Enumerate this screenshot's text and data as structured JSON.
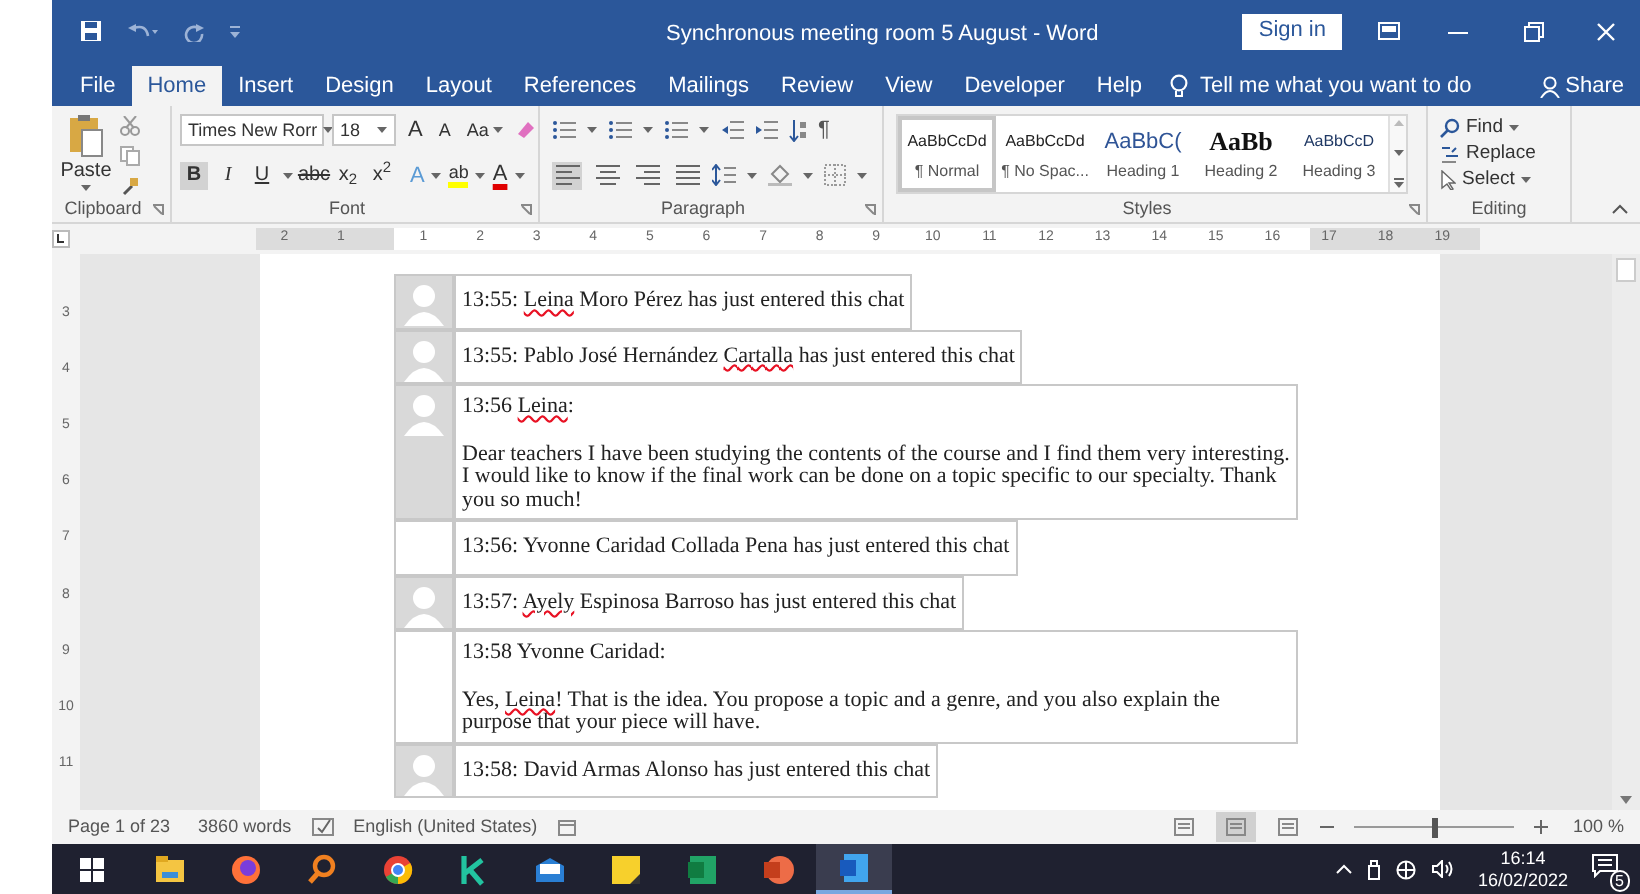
{
  "window": {
    "title": "Synchronous meeting room 5 August  -  Word",
    "sign_in": "Sign in"
  },
  "tabs": [
    {
      "label": "File",
      "selected": false
    },
    {
      "label": "Home",
      "selected": true
    },
    {
      "label": "Insert",
      "selected": false
    },
    {
      "label": "Design",
      "selected": false
    },
    {
      "label": "Layout",
      "selected": false
    },
    {
      "label": "References",
      "selected": false
    },
    {
      "label": "Mailings",
      "selected": false
    },
    {
      "label": "Review",
      "selected": false
    },
    {
      "label": "View",
      "selected": false
    },
    {
      "label": "Developer",
      "selected": false
    },
    {
      "label": "Help",
      "selected": false
    }
  ],
  "tell_me": {
    "placeholder": "Tell me what you want to do"
  },
  "share": "Share",
  "clipboard": {
    "paste": "Paste",
    "group_label": "Clipboard"
  },
  "font": {
    "name": "Times New Rorr",
    "size": "18",
    "grow": "A",
    "shrink": "A",
    "change_case": "Aa",
    "effects": "A",
    "highlight": "ab",
    "font_color_button": "A",
    "group_label": "Font",
    "format_buttons": [
      {
        "label": "B",
        "on": true
      },
      {
        "label": "I",
        "on": false
      },
      {
        "label": "U",
        "on": false
      },
      {
        "label": "abc",
        "on": false
      },
      {
        "label": "x$_{2}$",
        "on": false
      },
      {
        "label": "x$^{2}$",
        "on": false
      }
    ]
  },
  "paragraph": {
    "pilcrow": "¶",
    "group_label": "Paragraph",
    "alignments": [
      {
        "selected": true
      },
      {
        "selected": false
      },
      {
        "selected": false
      },
      {
        "selected": false
      }
    ]
  },
  "styles": {
    "group_label": "Styles",
    "items": [
      {
        "kind": "normal",
        "sample": "AaBbCcDd",
        "name": "¶ Normal",
        "selected": true
      },
      {
        "kind": "normal",
        "sample": "AaBbCcDd",
        "name": "¶ No Spac...",
        "selected": false
      },
      {
        "kind": "heading1",
        "sample": "AaBbC(",
        "name": "Heading 1",
        "selected": false
      },
      {
        "kind": "heading2",
        "sample": "AaBb",
        "name": "Heading 2",
        "selected": false
      },
      {
        "kind": "heading3",
        "sample": "AaBbCcD",
        "name": "Heading 3",
        "selected": false
      }
    ]
  },
  "editing": {
    "find": "Find",
    "replace": "Replace",
    "select": "Select",
    "group_label": "Editing"
  },
  "ruler": {
    "left_labels": [
      "2",
      "1"
    ],
    "right_labels": [
      "1",
      "2",
      "3",
      "4",
      "5",
      "6",
      "7",
      "8",
      "9",
      "10",
      "11",
      "12",
      "13",
      "14",
      "15",
      "16",
      "17",
      "18",
      "19"
    ],
    "vertical_labels": [
      "3",
      "4",
      "5",
      "6",
      "7",
      "8",
      "9",
      "10",
      "11"
    ]
  },
  "chat_rows": [
    {
      "avatar": true,
      "header": [
        {
          "text": "13:55: ",
          "misspelled": false
        },
        {
          "text": "Leina",
          "misspelled": true
        },
        {
          "text": " Moro Pérez has just entered this chat",
          "misspelled": false
        }
      ]
    },
    {
      "avatar": true,
      "header": [
        {
          "text": "13:55: Pablo José Hernández ",
          "misspelled": false
        },
        {
          "text": "Cartalla",
          "misspelled": true
        },
        {
          "text": " has just entered this chat",
          "misspelled": false
        }
      ]
    },
    {
      "avatar": true,
      "header": [
        {
          "text": "13:56 ",
          "misspelled": false
        },
        {
          "text": "Leina",
          "misspelled": true
        },
        {
          "text": ":",
          "misspelled": false
        }
      ],
      "body": [
        {
          "text": "Dear teachers I have been studying the contents of the course and I find them very interesting. I would like to know if the final work can be done on a topic specific to our specialty. Thank you so much!",
          "misspelled": false
        }
      ]
    },
    {
      "avatar": false,
      "header": [
        {
          "text": "13:56: Yvonne Caridad Collada Pena has just entered this chat",
          "misspelled": false
        }
      ]
    },
    {
      "avatar": true,
      "header": [
        {
          "text": "13:57: ",
          "misspelled": false
        },
        {
          "text": "Ayely",
          "misspelled": true
        },
        {
          "text": " Espinosa Barroso has just entered this chat",
          "misspelled": false
        }
      ]
    },
    {
      "avatar": false,
      "header": [
        {
          "text": "13:58 Yvonne Caridad:",
          "misspelled": false
        }
      ],
      "body": [
        {
          "text": "Yes, ",
          "misspelled": false
        },
        {
          "text": "Leina",
          "misspelled": true
        },
        {
          "text": "! That is the idea. You propose a topic and a genre, and you also explain the purpose that your piece will have.",
          "misspelled": false
        }
      ]
    },
    {
      "avatar": true,
      "header": [
        {
          "text": "13:58: David Armas Alonso has just entered this chat",
          "misspelled": false
        }
      ]
    }
  ],
  "status_bar": {
    "page": "Page 1 of 23",
    "words": "3860 words",
    "language": "English (United States)",
    "views": [
      {
        "selected": false
      },
      {
        "selected": true
      },
      {
        "selected": false
      }
    ],
    "zoom_slider": {
      "level": 0.5
    },
    "zoom": "100 %"
  },
  "taskbar": {
    "apps": [
      {
        "kind": "folder",
        "active": false
      },
      {
        "kind": "firefox",
        "active": false
      },
      {
        "kind": "search",
        "active": false
      },
      {
        "kind": "chrome",
        "active": false
      },
      {
        "kind": "k",
        "active": false
      },
      {
        "kind": "mail",
        "active": false
      },
      {
        "kind": "notes",
        "active": false
      },
      {
        "kind": "excel",
        "active": false
      },
      {
        "kind": "powerpoint",
        "active": false
      },
      {
        "kind": "word",
        "active": true
      }
    ],
    "time": "16:14",
    "date": "16/02/2022",
    "notifications": "5"
  }
}
